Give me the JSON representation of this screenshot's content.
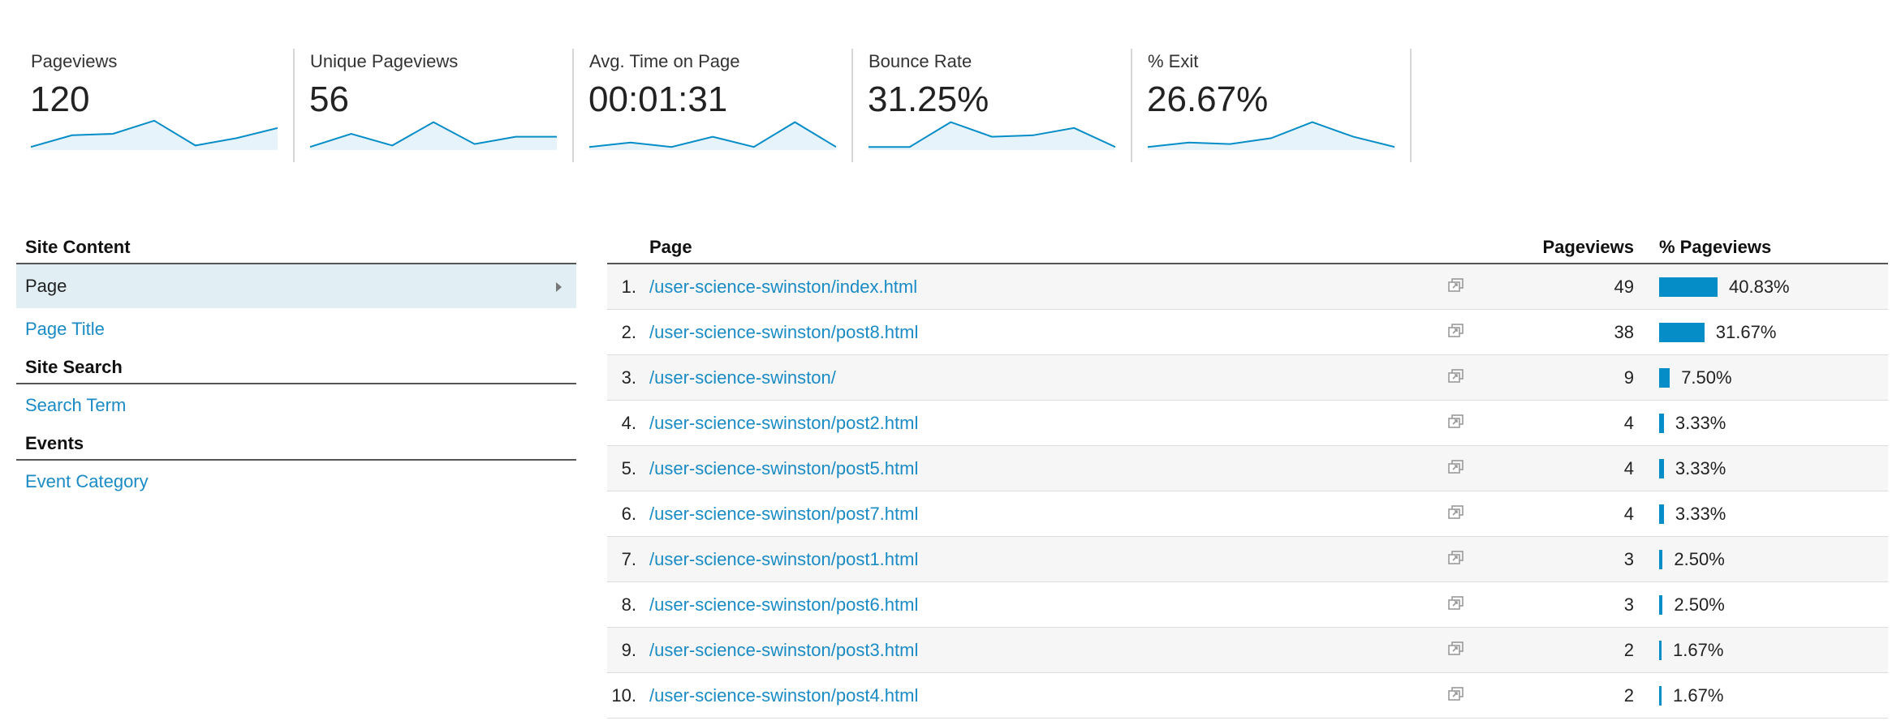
{
  "metrics": [
    {
      "label": "Pageviews",
      "value": "120",
      "spark": [
        0.05,
        0.45,
        0.5,
        0.95,
        0.1,
        0.35,
        0.7
      ]
    },
    {
      "label": "Unique Pageviews",
      "value": "56",
      "spark": [
        0.05,
        0.5,
        0.1,
        0.9,
        0.15,
        0.4,
        0.4
      ]
    },
    {
      "label": "Avg. Time on Page",
      "value": "00:01:31",
      "spark": [
        0.05,
        0.2,
        0.05,
        0.4,
        0.05,
        0.9,
        0.05
      ]
    },
    {
      "label": "Bounce Rate",
      "value": "31.25%",
      "spark": [
        0.05,
        0.05,
        0.9,
        0.4,
        0.45,
        0.7,
        0.05
      ]
    },
    {
      "label": "% Exit",
      "value": "26.67%",
      "spark": [
        0.05,
        0.2,
        0.15,
        0.35,
        0.9,
        0.4,
        0.05
      ]
    }
  ],
  "sidebar": {
    "sections": [
      {
        "heading": "Site Content",
        "items": [
          "Page",
          "Page Title"
        ]
      },
      {
        "heading": "Site Search",
        "items": [
          "Search Term"
        ]
      },
      {
        "heading": "Events",
        "items": [
          "Event Category"
        ]
      }
    ],
    "active_item": "Page"
  },
  "table": {
    "columns": {
      "page": "Page",
      "pageviews": "Pageviews",
      "pct": "% Pageviews"
    },
    "rows": [
      {
        "idx": "1.",
        "page": "/user-science-swinston/index.html",
        "pageviews": "49",
        "pct": "40.83%",
        "share": 40.83
      },
      {
        "idx": "2.",
        "page": "/user-science-swinston/post8.html",
        "pageviews": "38",
        "pct": "31.67%",
        "share": 31.67
      },
      {
        "idx": "3.",
        "page": "/user-science-swinston/",
        "pageviews": "9",
        "pct": "7.50%",
        "share": 7.5
      },
      {
        "idx": "4.",
        "page": "/user-science-swinston/post2.html",
        "pageviews": "4",
        "pct": "3.33%",
        "share": 3.33
      },
      {
        "idx": "5.",
        "page": "/user-science-swinston/post5.html",
        "pageviews": "4",
        "pct": "3.33%",
        "share": 3.33
      },
      {
        "idx": "6.",
        "page": "/user-science-swinston/post7.html",
        "pageviews": "4",
        "pct": "3.33%",
        "share": 3.33
      },
      {
        "idx": "7.",
        "page": "/user-science-swinston/post1.html",
        "pageviews": "3",
        "pct": "2.50%",
        "share": 2.5
      },
      {
        "idx": "8.",
        "page": "/user-science-swinston/post6.html",
        "pageviews": "3",
        "pct": "2.50%",
        "share": 2.5
      },
      {
        "idx": "9.",
        "page": "/user-science-swinston/post3.html",
        "pageviews": "2",
        "pct": "1.67%",
        "share": 1.67
      },
      {
        "idx": "10.",
        "page": "/user-science-swinston/post4.html",
        "pageviews": "2",
        "pct": "1.67%",
        "share": 1.67
      }
    ]
  },
  "colors": {
    "link": "#1a8bc4",
    "bar": "#058dc7",
    "spark_line": "#058dc7",
    "spark_fill": "#e6f3fa",
    "active_bg": "#e1eff5"
  },
  "icons": {
    "row_action": "open-in-new-window-icon",
    "nav_active": "chevron-right-icon"
  }
}
